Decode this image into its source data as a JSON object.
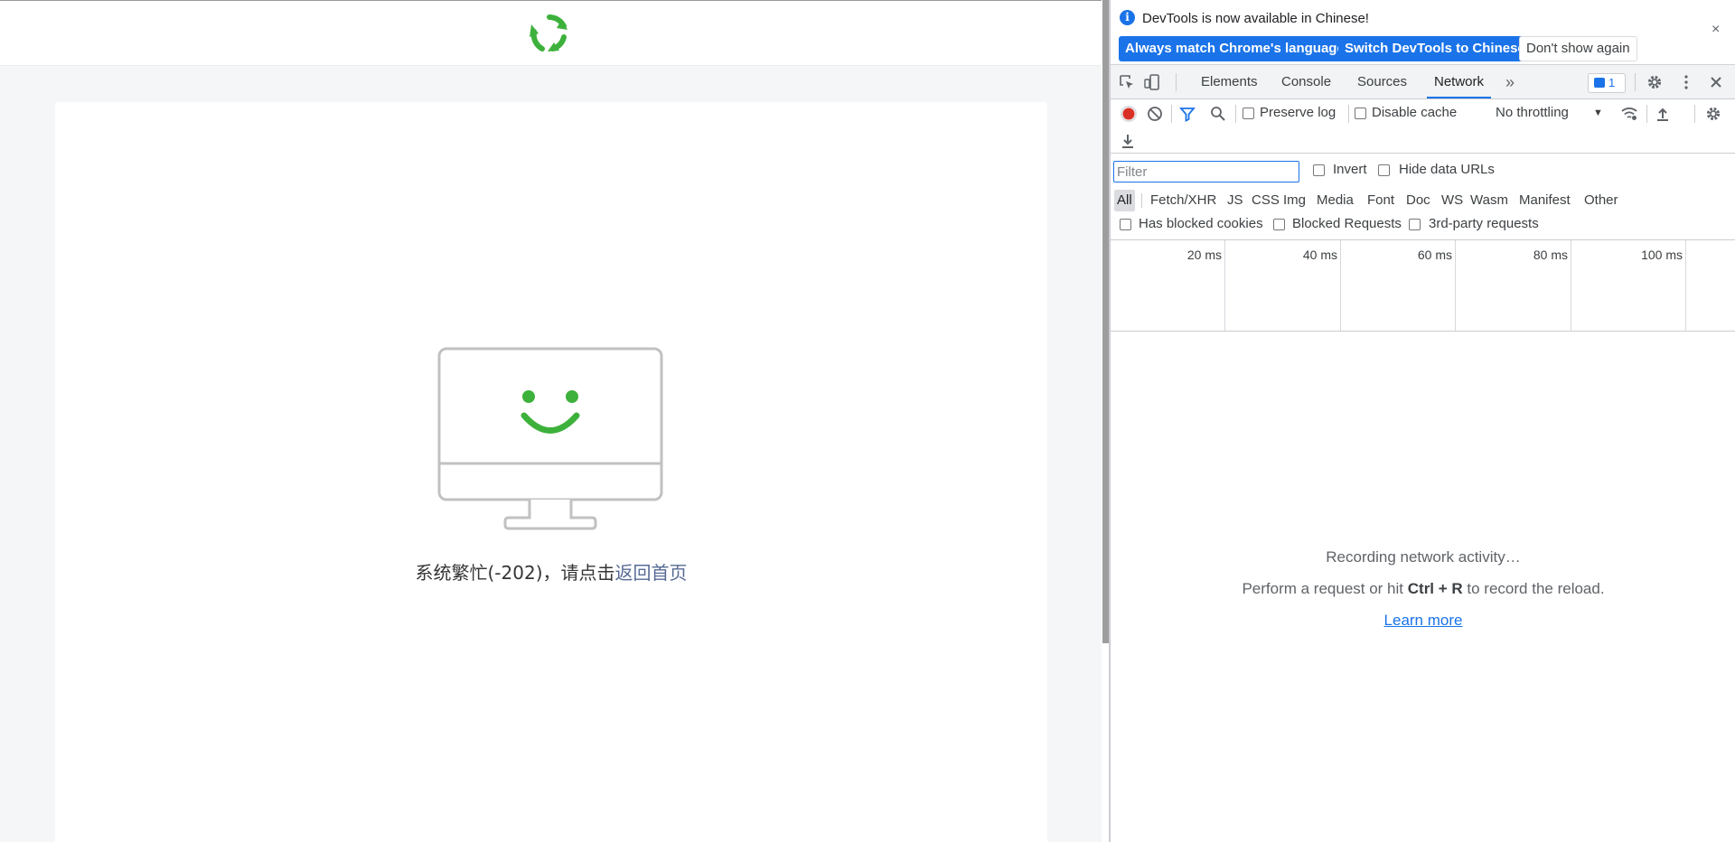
{
  "page": {
    "error_text": "系统繁忙(-202)，请点击",
    "error_link": "返回首页",
    "colors": {
      "brand_green": "#3db13b",
      "link": "#576b95"
    }
  },
  "devtools": {
    "infobar": {
      "message": "DevTools is now available in Chinese!",
      "btn_match": "Always match Chrome's language",
      "btn_switch": "Switch DevTools to Chinese",
      "btn_dismiss": "Don't show again",
      "close": "×"
    },
    "tabs": [
      "Elements",
      "Console",
      "Sources",
      "Network"
    ],
    "active_tab": "Network",
    "more_tabs": "»",
    "issues_count": "1",
    "toolbar": {
      "preserve_log": "Preserve log",
      "disable_cache": "Disable cache",
      "throttling": "No throttling"
    },
    "filter": {
      "placeholder": "Filter",
      "invert": "Invert",
      "hide_data_urls": "Hide data URLs",
      "types": [
        "All",
        "Fetch/XHR",
        "JS",
        "CSS",
        "Img",
        "Media",
        "Font",
        "Doc",
        "WS",
        "Wasm",
        "Manifest",
        "Other"
      ],
      "has_blocked_cookies": "Has blocked cookies",
      "blocked_requests": "Blocked Requests",
      "third_party": "3rd-party requests"
    },
    "timeline": {
      "ticks": [
        "20 ms",
        "40 ms",
        "60 ms",
        "80 ms",
        "100 ms"
      ]
    },
    "empty": {
      "recording": "Recording network activity…",
      "hint_pre": "Perform a request or hit ",
      "hint_keys": "Ctrl + R",
      "hint_post": " to record the reload.",
      "learn_more": "Learn more"
    },
    "colors": {
      "accent": "#1a73e8",
      "record": "#d93025"
    }
  }
}
